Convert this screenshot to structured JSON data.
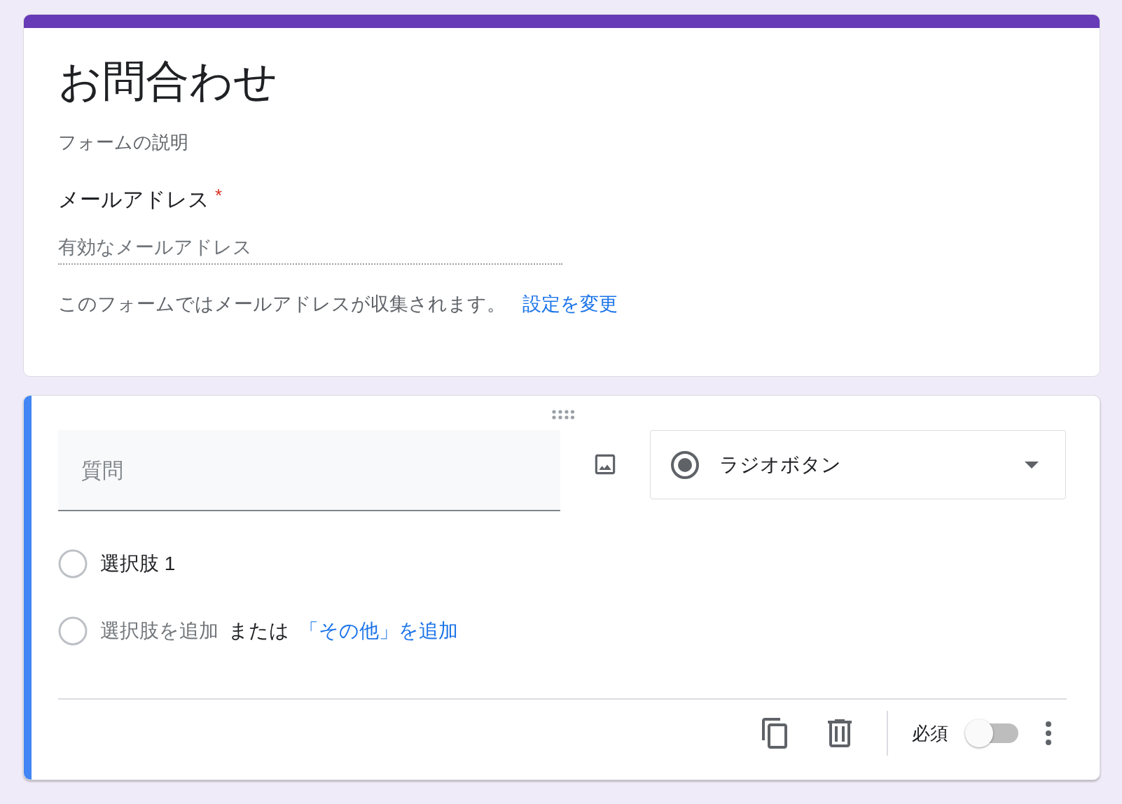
{
  "form_header": {
    "title": "お問合わせ",
    "description_placeholder": "フォームの説明",
    "email_question": {
      "label": "メールアドレス",
      "required_mark": "*",
      "placeholder": "有効なメールアドレス"
    },
    "notice": "このフォームではメールアドレスが収集されます。",
    "notice_link": "設定を変更"
  },
  "question_card": {
    "question_placeholder": "質問",
    "type_dropdown": {
      "value": "ラジオボタン"
    },
    "options": [
      {
        "kind": "option",
        "label": "選択肢 1"
      },
      {
        "kind": "add",
        "label": "選択肢を追加",
        "separator": "または",
        "link": "「その他」を追加"
      }
    ],
    "footer": {
      "required_label": "必須",
      "required_on": false
    }
  }
}
